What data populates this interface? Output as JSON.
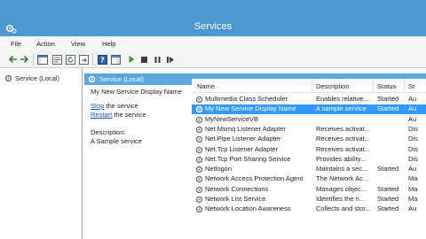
{
  "window": {
    "title": "Services"
  },
  "menu": {
    "items": [
      "File",
      "Action",
      "View",
      "Help"
    ]
  },
  "toolbar": {
    "icons": [
      "back-arrow-icon",
      "forward-arrow-icon",
      "console-tree-icon",
      "properties-icon",
      "refresh-icon",
      "export-list-icon",
      "help-icon",
      "show-action-pane-icon",
      "play-icon",
      "stop-icon",
      "pause-icon",
      "restart-icon"
    ]
  },
  "tree": {
    "node_label": "Service (Local)"
  },
  "pane": {
    "header": "Service (Local)"
  },
  "description": {
    "selected_name": "My New Service Display Name",
    "stop_link": "Stop",
    "stop_rest": " the service",
    "restart_link": "Restart",
    "restart_rest": " the service",
    "desc_label": "Description:",
    "desc_text": "A Sample service"
  },
  "columns": {
    "name": "Name",
    "description": "Description",
    "status": "Status",
    "startup": "St"
  },
  "rows": [
    {
      "name": "Multimedia Class Scheduler",
      "description": "Enables relative...",
      "status": "Started",
      "startup": "Au"
    },
    {
      "name": "My New Service Display Name",
      "description": "A sample service",
      "status": "Started",
      "startup": "Au",
      "selected": true
    },
    {
      "name": "MyNewServiceVB",
      "description": "",
      "status": "",
      "startup": "Au"
    },
    {
      "name": "Net.Msmq Listener Adapter",
      "description": "Receives activat...",
      "status": "",
      "startup": "Dis"
    },
    {
      "name": "Net.Pipe Listener Adapter",
      "description": "Receives activat...",
      "status": "",
      "startup": "Dis"
    },
    {
      "name": "Net.Tcp Listener Adapter",
      "description": "Receives activat...",
      "status": "",
      "startup": "Dis"
    },
    {
      "name": "Net.Tcp Port Sharing Service",
      "description": "Provides ability...",
      "status": "",
      "startup": "Dis"
    },
    {
      "name": "Netlogon",
      "description": "Maintains a sec...",
      "status": "Started",
      "startup": "Au"
    },
    {
      "name": "Network Access Protection Agent",
      "description": "The Network Ac...",
      "status": "",
      "startup": "Ma"
    },
    {
      "name": "Network Connections",
      "description": "Manages objec...",
      "status": "Started",
      "startup": "Ma"
    },
    {
      "name": "Network List Service",
      "description": "Identifies the n...",
      "status": "Started",
      "startup": "Ma"
    },
    {
      "name": "Network Location Awareness",
      "description": "Collects and stor...",
      "status": "Started",
      "startup": "Au"
    }
  ],
  "colors": {
    "titlebar": "#4a99d1",
    "header": "#5aa6de",
    "selection": "#3399ff",
    "link": "#1a55b4"
  }
}
